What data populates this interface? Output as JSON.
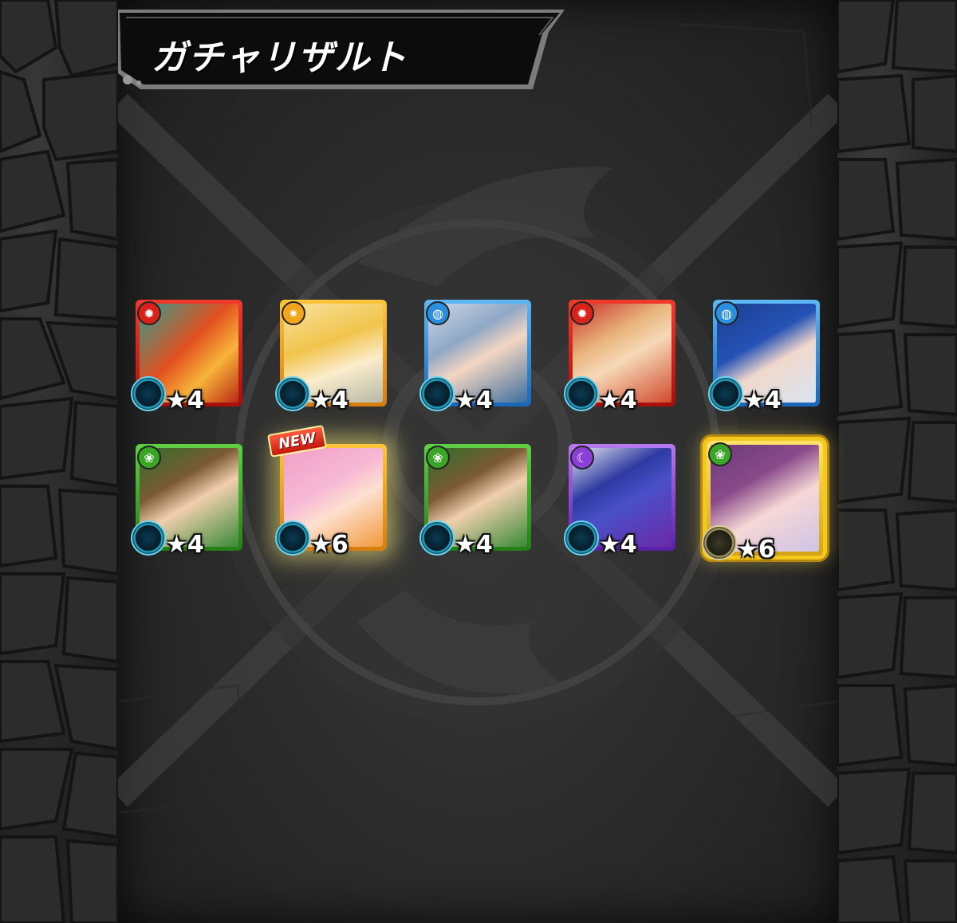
{
  "header": {
    "title": "ガチャリザルト"
  },
  "colors": {
    "fire": "#d8231a",
    "light": "#f2a51b",
    "water": "#2b8fe0",
    "wood": "#3aa526",
    "dark": "#8a3fd6",
    "gold_frame": "#f5c81c"
  },
  "results": [
    {
      "element": "fire",
      "element_icon": "fire-icon",
      "star_label": "★4",
      "is_new": false,
      "badge": "",
      "highlight": "none",
      "character": "phoenix-bird"
    },
    {
      "element": "light",
      "element_icon": "light-icon",
      "star_label": "★4",
      "is_new": false,
      "badge": "",
      "highlight": "none",
      "character": "blonde-woman"
    },
    {
      "element": "water",
      "element_icon": "water-icon",
      "star_label": "★4",
      "is_new": false,
      "badge": "",
      "highlight": "none",
      "character": "white-hair-boy-glasses"
    },
    {
      "element": "fire",
      "element_icon": "fire-icon",
      "star_label": "★4",
      "is_new": false,
      "badge": "",
      "highlight": "none",
      "character": "girl-with-fan"
    },
    {
      "element": "water",
      "element_icon": "water-icon",
      "star_label": "★4",
      "is_new": false,
      "badge": "",
      "highlight": "none",
      "character": "blue-hair-girl"
    },
    {
      "element": "wood",
      "element_icon": "wood-icon",
      "star_label": "★4",
      "is_new": false,
      "badge": "",
      "highlight": "none",
      "character": "witch-hat-boy"
    },
    {
      "element": "light",
      "element_icon": "light-icon",
      "star_label": "★6",
      "is_new": true,
      "badge": "NEW",
      "highlight": "glow",
      "character": "pink-hair-girl"
    },
    {
      "element": "wood",
      "element_icon": "wood-icon",
      "star_label": "★4",
      "is_new": false,
      "badge": "",
      "highlight": "none",
      "character": "witch-hat-boy"
    },
    {
      "element": "dark",
      "element_icon": "dark-icon",
      "star_label": "★4",
      "is_new": false,
      "badge": "",
      "highlight": "none",
      "character": "blue-oni"
    },
    {
      "element": "wood",
      "element_icon": "wood-icon",
      "star_label": "★6",
      "is_new": false,
      "badge": "",
      "highlight": "gold",
      "character": "purple-hair-girl"
    }
  ]
}
